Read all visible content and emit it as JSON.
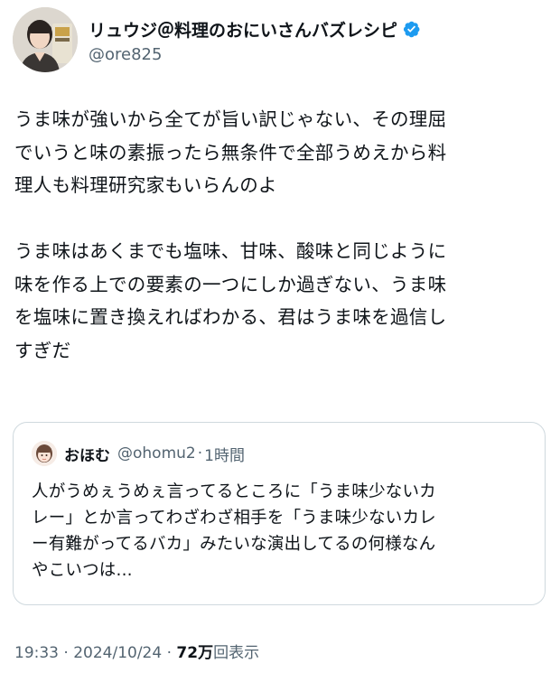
{
  "author": {
    "display_name": "リュウジ＠料理のおにいさんバズレシピ",
    "handle": "@ore825",
    "verified": true
  },
  "tweet": {
    "text": "うま味が強いから全てが旨い訳じゃない、その理屈\nでいうと味の素振ったら無条件で全部うめえから料\n理人も料理研究家もいらんのよ\n\nうま味はあくまでも塩味、甘味、酸味と同じように\n味を作る上での要素の一つにしか過ぎない、うま味\nを塩味に置き換えればわかる、君はうま味を過信し\nすぎだ"
  },
  "quote": {
    "display_name": "おほむ",
    "handle": "@ohomu2",
    "separator": "·",
    "time": "1時間",
    "text": "人がうめぇうめぇ言ってるところに「うま味少ないカ\nレー」とか言ってわざわざ相手を「うま味少ないカレ\nー有難がってるバカ」みたいな演出してるの何様なん\nやこいつは..."
  },
  "meta": {
    "timestamp": "19:33 · 2024/10/24 · ",
    "views_count": "72万",
    "views_label": "回表示"
  },
  "colors": {
    "verified_blue": "#1d9bf0",
    "secondary_text": "#536471",
    "primary_text": "#0f1419",
    "border": "#cfd9de"
  },
  "icons": {
    "verified": "verified-badge-icon"
  }
}
